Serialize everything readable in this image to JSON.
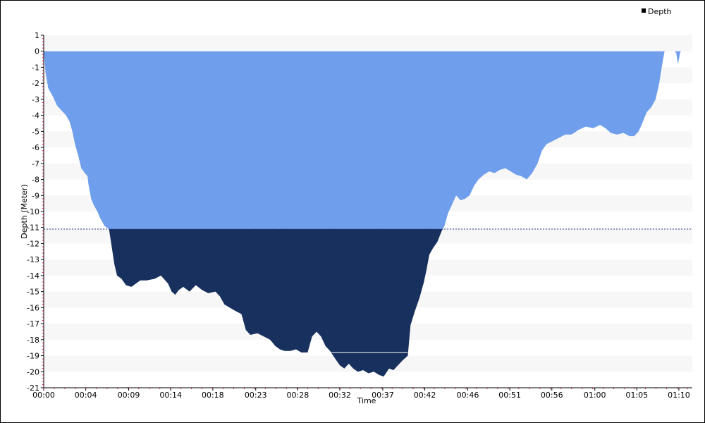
{
  "chart_data": {
    "type": "area",
    "xlabel": "Time",
    "ylabel": "Depth (Meter)",
    "legend": {
      "position": "top-right",
      "entries": [
        "Depth"
      ]
    },
    "ylim": [
      -21,
      1
    ],
    "xlim_minutes": [
      0,
      72.5
    ],
    "grid": "alternating horizontal bands",
    "threshold_depth": -11.1,
    "colors": {
      "shallow_fill": "#6f9fec",
      "deep_fill": "#17305e",
      "band": "#f7f7f7",
      "threshold_line": "#2a3c8a",
      "axis_tick": "#c0103a",
      "legend_marker": "#000000"
    },
    "y_ticks": [
      "1",
      "0",
      "-1",
      "-2",
      "-3",
      "-4",
      "-5",
      "-6",
      "-7",
      "-8",
      "-9",
      "-10",
      "-11",
      "-12",
      "-13",
      "-14",
      "-15",
      "-16",
      "-17",
      "-18",
      "-19",
      "-20",
      "-21"
    ],
    "x_ticks": [
      {
        "label": "00:00",
        "minute": 0
      },
      {
        "label": "00:04",
        "minute": 4.7
      },
      {
        "label": "00:09",
        "minute": 9.5
      },
      {
        "label": "00:14",
        "minute": 14.2
      },
      {
        "label": "00:18",
        "minute": 18.9
      },
      {
        "label": "00:23",
        "minute": 23.7
      },
      {
        "label": "00:28",
        "minute": 28.4
      },
      {
        "label": "00:32",
        "minute": 33.1
      },
      {
        "label": "00:37",
        "minute": 37.9
      },
      {
        "label": "00:42",
        "minute": 42.6
      },
      {
        "label": "00:46",
        "minute": 47.4
      },
      {
        "label": "00:51",
        "minute": 52.1
      },
      {
        "label": "00:56",
        "minute": 56.8
      },
      {
        "label": "01:00",
        "minute": 61.6
      },
      {
        "label": "01:05",
        "minute": 66.3
      },
      {
        "label": "01:10",
        "minute": 71.0
      }
    ],
    "series": [
      {
        "name": "Depth",
        "points": [
          [
            0,
            0
          ],
          [
            0.2,
            -1.3
          ],
          [
            0.5,
            -2.3
          ],
          [
            1.0,
            -2.8
          ],
          [
            1.5,
            -3.4
          ],
          [
            2.0,
            -3.7
          ],
          [
            2.5,
            -4.0
          ],
          [
            2.9,
            -4.4
          ],
          [
            3.2,
            -5.0
          ],
          [
            3.5,
            -5.8
          ],
          [
            3.9,
            -6.6
          ],
          [
            4.2,
            -7.3
          ],
          [
            4.6,
            -7.6
          ],
          [
            4.9,
            -7.8
          ],
          [
            5.0,
            -8.3
          ],
          [
            5.3,
            -9.2
          ],
          [
            5.6,
            -9.6
          ],
          [
            6.0,
            -10.0
          ],
          [
            6.3,
            -10.4
          ],
          [
            6.8,
            -10.9
          ],
          [
            7.3,
            -11.1
          ],
          [
            7.6,
            -12.2
          ],
          [
            7.9,
            -13.3
          ],
          [
            8.2,
            -14.0
          ],
          [
            8.7,
            -14.2
          ],
          [
            9.2,
            -14.6
          ],
          [
            9.8,
            -14.7
          ],
          [
            10.3,
            -14.5
          ],
          [
            10.8,
            -14.3
          ],
          [
            11.5,
            -14.3
          ],
          [
            12.4,
            -14.2
          ],
          [
            13.1,
            -14.0
          ],
          [
            13.9,
            -14.5
          ],
          [
            14.3,
            -15.0
          ],
          [
            14.7,
            -15.2
          ],
          [
            15.1,
            -14.9
          ],
          [
            15.6,
            -14.7
          ],
          [
            16.3,
            -15.0
          ],
          [
            17.0,
            -14.6
          ],
          [
            17.7,
            -14.9
          ],
          [
            18.4,
            -15.1
          ],
          [
            19.2,
            -15.0
          ],
          [
            19.7,
            -15.3
          ],
          [
            20.2,
            -15.8
          ],
          [
            20.8,
            -16.0
          ],
          [
            21.4,
            -16.2
          ],
          [
            22.1,
            -16.4
          ],
          [
            22.6,
            -17.4
          ],
          [
            23.1,
            -17.7
          ],
          [
            23.9,
            -17.6
          ],
          [
            24.6,
            -17.8
          ],
          [
            25.3,
            -18.0
          ],
          [
            25.9,
            -18.4
          ],
          [
            26.4,
            -18.6
          ],
          [
            26.9,
            -18.7
          ],
          [
            27.6,
            -18.7
          ],
          [
            28.2,
            -18.6
          ],
          [
            28.8,
            -18.8
          ],
          [
            29.5,
            -18.8
          ],
          [
            30.0,
            -17.8
          ],
          [
            30.5,
            -17.5
          ],
          [
            31.0,
            -17.8
          ],
          [
            31.5,
            -18.4
          ],
          [
            32.0,
            -18.7
          ],
          [
            32.6,
            -19.2
          ],
          [
            33.1,
            -19.6
          ],
          [
            33.6,
            -19.8
          ],
          [
            34.1,
            -19.5
          ],
          [
            34.6,
            -19.8
          ],
          [
            35.1,
            -20.0
          ],
          [
            35.7,
            -19.9
          ],
          [
            36.3,
            -20.1
          ],
          [
            36.9,
            -20.0
          ],
          [
            37.5,
            -20.2
          ],
          [
            38.0,
            -20.3
          ],
          [
            38.6,
            -19.8
          ],
          [
            39.1,
            -19.9
          ],
          [
            39.6,
            -19.6
          ],
          [
            40.1,
            -19.3
          ],
          [
            40.7,
            -19.0
          ],
          [
            41.0,
            -17.1
          ],
          [
            41.5,
            -16.2
          ],
          [
            42.0,
            -15.4
          ],
          [
            42.5,
            -14.4
          ],
          [
            42.8,
            -13.6
          ],
          [
            43.1,
            -12.7
          ],
          [
            43.5,
            -12.3
          ],
          [
            44.0,
            -11.9
          ],
          [
            44.5,
            -11.2
          ],
          [
            44.8,
            -10.9
          ],
          [
            45.2,
            -10.1
          ],
          [
            45.7,
            -9.5
          ],
          [
            46.1,
            -9.0
          ],
          [
            46.6,
            -9.3
          ],
          [
            47.1,
            -9.2
          ],
          [
            47.6,
            -9.0
          ],
          [
            48.1,
            -8.4
          ],
          [
            48.6,
            -8.0
          ],
          [
            49.2,
            -7.7
          ],
          [
            49.8,
            -7.5
          ],
          [
            50.4,
            -7.6
          ],
          [
            51.0,
            -7.4
          ],
          [
            51.6,
            -7.3
          ],
          [
            52.2,
            -7.5
          ],
          [
            52.8,
            -7.7
          ],
          [
            53.4,
            -7.8
          ],
          [
            54.0,
            -8.0
          ],
          [
            54.6,
            -7.6
          ],
          [
            55.2,
            -7.0
          ],
          [
            55.7,
            -6.2
          ],
          [
            56.2,
            -5.8
          ],
          [
            56.9,
            -5.6
          ],
          [
            57.6,
            -5.4
          ],
          [
            58.3,
            -5.2
          ],
          [
            59.0,
            -5.2
          ],
          [
            59.8,
            -4.9
          ],
          [
            60.6,
            -4.7
          ],
          [
            61.4,
            -4.8
          ],
          [
            62.2,
            -4.6
          ],
          [
            62.8,
            -4.8
          ],
          [
            63.4,
            -5.1
          ],
          [
            64.1,
            -5.2
          ],
          [
            64.8,
            -5.1
          ],
          [
            65.5,
            -5.3
          ],
          [
            66.0,
            -5.3
          ],
          [
            66.5,
            -5.0
          ],
          [
            66.9,
            -4.5
          ],
          [
            67.4,
            -3.8
          ],
          [
            67.9,
            -3.5
          ],
          [
            68.4,
            -3.0
          ],
          [
            68.8,
            -2.0
          ],
          [
            69.2,
            -0.6
          ],
          [
            69.4,
            0
          ],
          [
            70.5,
            0
          ],
          [
            70.7,
            -0.1
          ],
          [
            70.9,
            -0.8
          ],
          [
            71.1,
            -0.2
          ],
          [
            71.2,
            0
          ]
        ]
      }
    ],
    "annotations": [
      {
        "type": "flat-line",
        "from_minute": 30.5,
        "to_minute": 40.7,
        "depth": -18.8,
        "color": "#ffffff"
      }
    ]
  }
}
